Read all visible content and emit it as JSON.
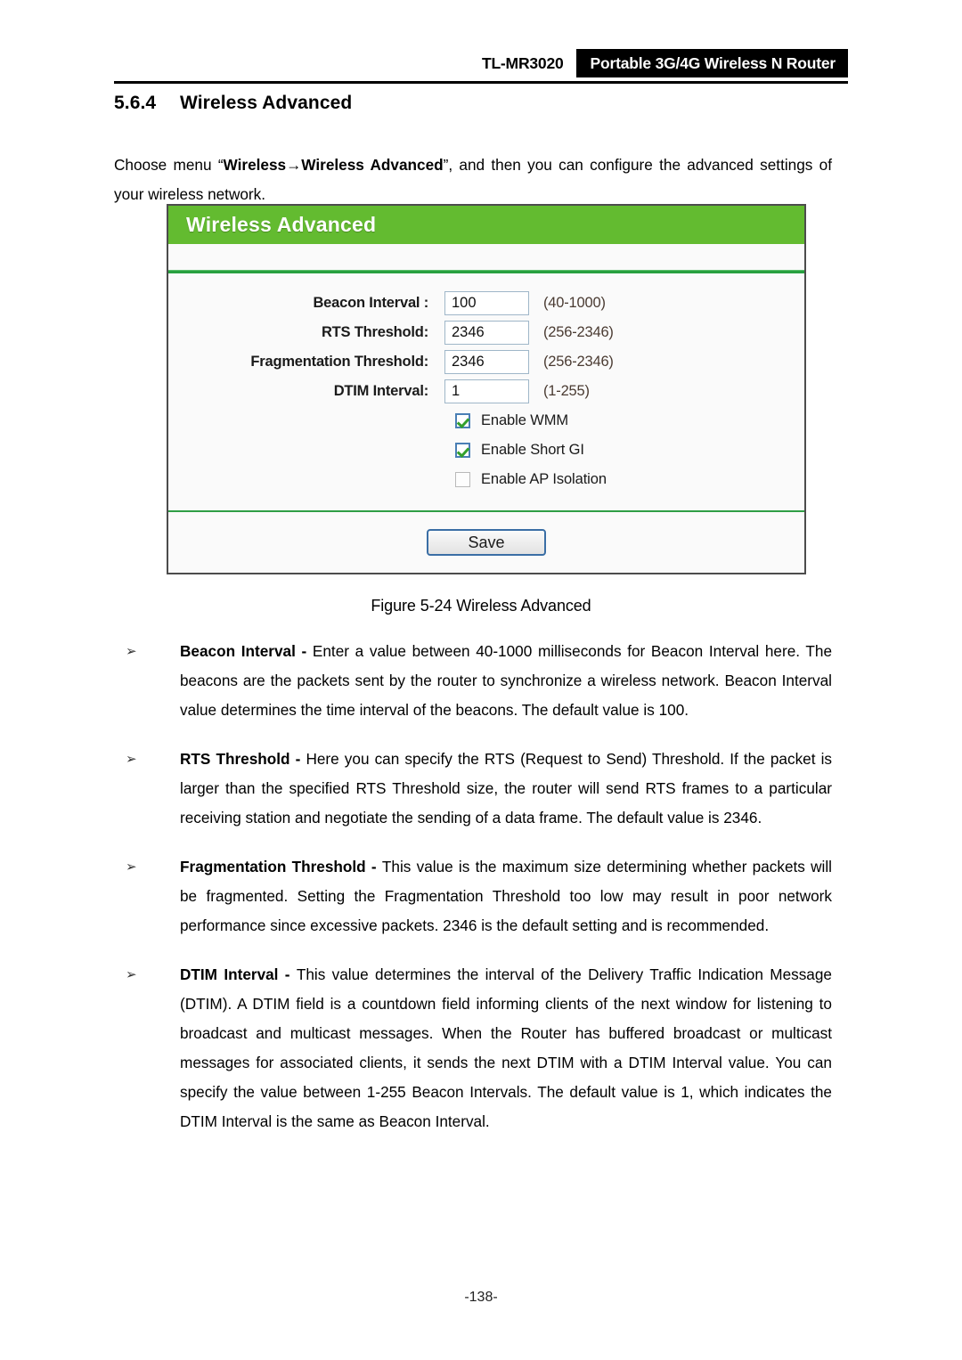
{
  "header": {
    "model": "TL-MR3020",
    "product": "Portable 3G/4G Wireless N Router"
  },
  "section": {
    "number": "5.6.4",
    "title": "Wireless Advanced"
  },
  "intro": {
    "before": "Choose menu “",
    "menu_path": "Wireless→Wireless Advanced",
    "after": "”, and then you can configure the advanced settings of your wireless network."
  },
  "router_ui": {
    "title": "Wireless Advanced",
    "fields": [
      {
        "label": "Beacon Interval :",
        "value": "100",
        "hint": "(40-1000)"
      },
      {
        "label": "RTS Threshold:",
        "value": "2346",
        "hint": "(256-2346)"
      },
      {
        "label": "Fragmentation Threshold:",
        "value": "2346",
        "hint": "(256-2346)"
      },
      {
        "label": "DTIM Interval:",
        "value": "1",
        "hint": "(1-255)"
      }
    ],
    "checkboxes": [
      {
        "label": "Enable WMM",
        "checked": true
      },
      {
        "label": "Enable Short GI",
        "checked": true
      },
      {
        "label": "Enable AP Isolation",
        "checked": false
      }
    ],
    "save_label": "Save",
    "colors": {
      "header_green": "#63bb30",
      "divider_green": "#27a03f",
      "input_border": "#9fb6c8",
      "check_green": "#33a02c",
      "button_border": "#3a6ea5"
    }
  },
  "figure_caption": "Figure 5-24 Wireless Advanced",
  "bullets": [
    {
      "marker": "➢",
      "term": "Beacon Interval",
      "separator": " - ",
      "text": "Enter a value between 40-1000 milliseconds for Beacon Interval here. The beacons are the packets sent by the router to synchronize a wireless network. Beacon Interval value determines the time interval of the beacons. The default value is 100."
    },
    {
      "marker": "➢",
      "term": "RTS Threshold",
      "separator": " - ",
      "text": "Here you can specify the RTS (Request to Send) Threshold. If the packet is larger than the specified RTS Threshold size, the router will send RTS frames to a particular receiving station and negotiate the sending of a data frame. The default value is 2346."
    },
    {
      "marker": "➢",
      "term": "Fragmentation Threshold",
      "separator": " - ",
      "text": "This value is the maximum size determining whether packets will be fragmented. Setting the Fragmentation Threshold too low may result in poor network performance since excessive packets. 2346 is the default setting and is recommended."
    },
    {
      "marker": "➢",
      "term": "DTIM Interval",
      "separator": " - ",
      "text": "This value determines the interval of the Delivery Traffic Indication Message (DTIM). A DTIM field is a countdown field informing clients of the next window for listening to broadcast and multicast messages. When the Router has buffered broadcast or multicast messages for associated clients, it sends the next DTIM with a DTIM Interval value. You can specify the value between 1-255 Beacon Intervals. The default value is 1, which indicates the DTIM Interval is the same as Beacon Interval."
    }
  ],
  "page_number": "-138-"
}
